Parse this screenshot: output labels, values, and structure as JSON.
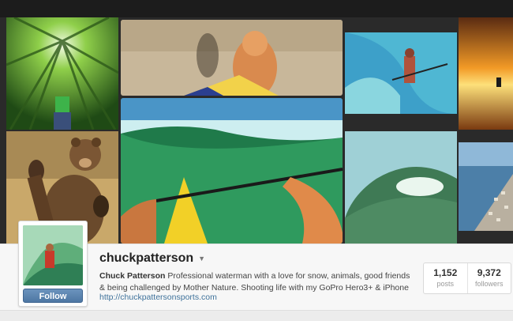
{
  "profile": {
    "username": "chuckpatterson",
    "full_name": "Chuck Patterson",
    "bio": "Professional waterman with a love for snow, animals, good friends & being challenged by Mother Nature. Shooting life with my GoPro Hero3+ & iPhone",
    "website": "http://chuckpattersonsports.com",
    "follow_label": "Follow"
  },
  "stats": [
    {
      "value": "1,152",
      "label": "posts"
    },
    {
      "value": "9,372",
      "label": "followers"
    }
  ],
  "photos": [
    {
      "name": "bamboo-forest"
    },
    {
      "name": "beach-selfie-paddleboard"
    },
    {
      "name": "surfer-in-barrel"
    },
    {
      "name": "sunset-surfer"
    },
    {
      "name": "bear-waving"
    },
    {
      "name": "paddleboard-wave-pov"
    },
    {
      "name": "wave-tube"
    },
    {
      "name": "coastal-aerial"
    }
  ],
  "colors": {
    "link": "#3f729b",
    "follow_button": "#5a83ae"
  }
}
